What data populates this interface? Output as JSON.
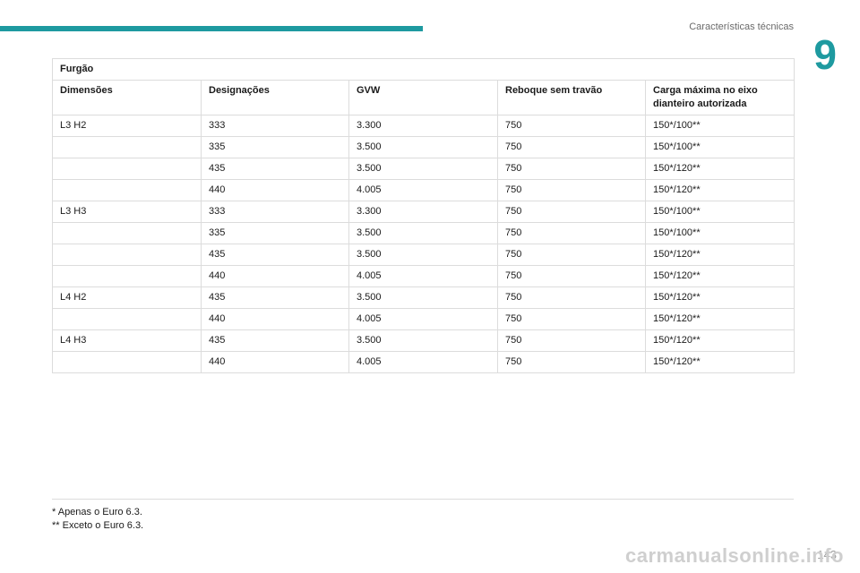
{
  "header": {
    "section_title": "Características técnicas",
    "chapter_number": "9"
  },
  "table": {
    "title": "Furgão",
    "columns": [
      "Dimensões",
      "Designações",
      "GVW",
      "Reboque sem travão",
      "Carga máxima no eixo dianteiro autorizada"
    ],
    "groups": [
      {
        "dimension": "L3 H2",
        "rows": [
          [
            "333",
            "3.300",
            "750",
            "150*/100**"
          ],
          [
            "335",
            "3.500",
            "750",
            "150*/100**"
          ],
          [
            "435",
            "3.500",
            "750",
            "150*/120**"
          ],
          [
            "440",
            "4.005",
            "750",
            "150*/120**"
          ]
        ]
      },
      {
        "dimension": "L3 H3",
        "rows": [
          [
            "333",
            "3.300",
            "750",
            "150*/100**"
          ],
          [
            "335",
            "3.500",
            "750",
            "150*/100**"
          ],
          [
            "435",
            "3.500",
            "750",
            "150*/120**"
          ],
          [
            "440",
            "4.005",
            "750",
            "150*/120**"
          ]
        ]
      },
      {
        "dimension": "L4 H2",
        "rows": [
          [
            "435",
            "3.500",
            "750",
            "150*/120**"
          ],
          [
            "440",
            "4.005",
            "750",
            "150*/120**"
          ]
        ]
      },
      {
        "dimension": "L4 H3",
        "rows": [
          [
            "435",
            "3.500",
            "750",
            "150*/120**"
          ],
          [
            "440",
            "4.005",
            "750",
            "150*/120**"
          ]
        ]
      }
    ]
  },
  "footnotes": [
    "* Apenas o Euro 6.3.",
    "** Exceto o Euro 6.3."
  ],
  "page_number": "143",
  "watermark": "carmanualsonline.info",
  "colors": {
    "accent": "#1e9aa0",
    "border": "#dcdcdc"
  }
}
